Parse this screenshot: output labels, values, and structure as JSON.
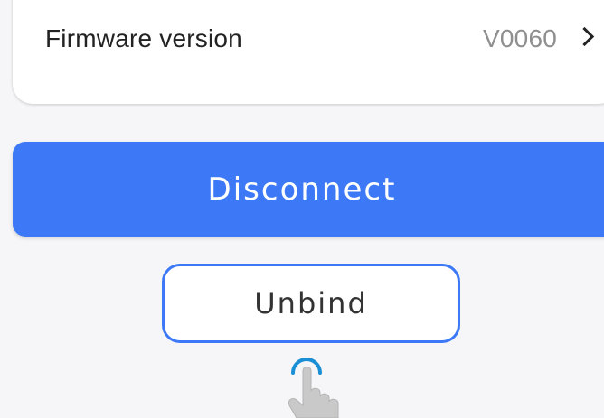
{
  "settings_row": {
    "label": "Firmware version",
    "value": "V0060"
  },
  "actions": {
    "disconnect_label": "Disconnect",
    "unbind_label": "Unbind"
  },
  "colors": {
    "accent": "#3d79f7",
    "background": "#f6f6f8",
    "card": "#ffffff",
    "muted_text": "#8f8f8f",
    "tap_ring": "#1a8fd6"
  },
  "icons": {
    "row_arrow": "chevron-right-icon",
    "tap_hint": "tap-hand-icon"
  }
}
